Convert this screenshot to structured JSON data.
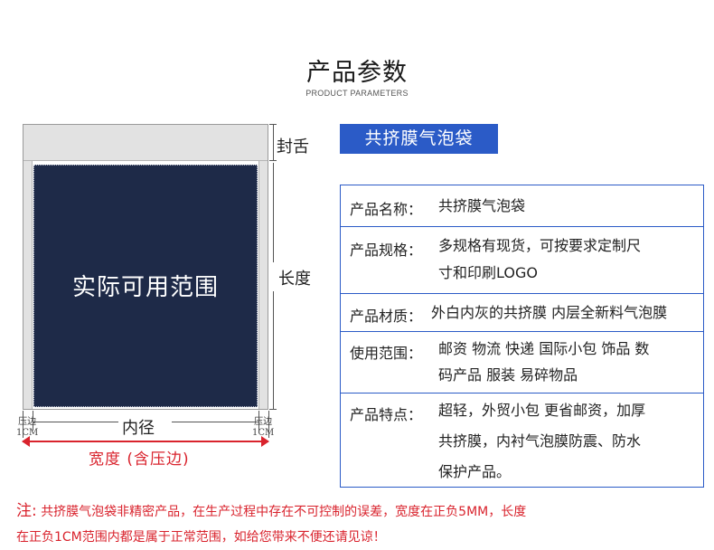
{
  "header": {
    "title": "产品参数",
    "subtitle": "PRODUCT PARAMETERS"
  },
  "diagram": {
    "seal_flap_label": "封舌",
    "length_label": "长度",
    "usable_area_label": "实际可用范围",
    "inner_width_label": "内径",
    "press_edge_label": "压边",
    "press_edge_size": "1CM",
    "total_width_label": "宽度  (含压边)"
  },
  "product_badge": "共挤膜气泡袋",
  "specs": [
    {
      "key": "产品名称：",
      "lines": [
        "共挤膜气泡袋"
      ]
    },
    {
      "key": "产品规格：",
      "lines": [
        "多规格有现货，可按要求定制尺",
        "寸和印刷LOGO"
      ]
    },
    {
      "key": "产品材质：",
      "lines": [
        "外白内灰的共挤膜 内层全新料气泡膜"
      ]
    },
    {
      "key": "使用范围：",
      "lines": [
        "邮资 物流 快递 国际小包 饰品 数",
        "码产品 服装 易碎物品"
      ]
    },
    {
      "key": "产品特点：",
      "lines": [
        "超轻，外贸小包 更省邮资，加厚",
        "共挤膜，内衬气泡膜防震、防水",
        "保护产品。"
      ]
    }
  ],
  "note": {
    "mark": "注:",
    "line1": "共挤膜气泡袋非精密产品，在生产过程中存在不可控制的误差，宽度在正负5MM，长度",
    "line2": "在正负1CM范围内都是属于正常范围，如给您带来不便还请见谅！"
  },
  "colors": {
    "accent_blue": "#2b5bc7",
    "usable_navy": "#1e2a48",
    "note_red": "#d9232d"
  }
}
